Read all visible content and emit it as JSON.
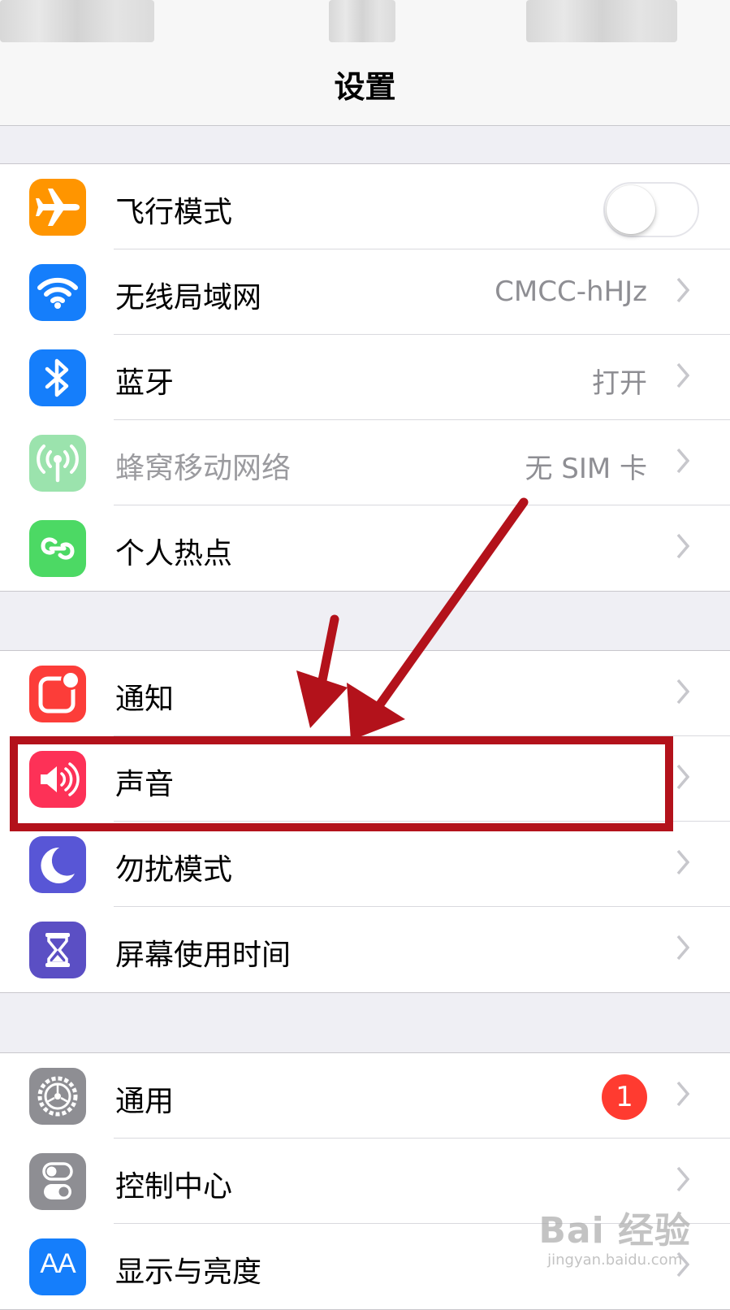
{
  "nav": {
    "title": "设置"
  },
  "group1": {
    "items": [
      {
        "label": "飞行模式",
        "icon": "airplane-icon",
        "color": "#ff9500",
        "toggle": false
      },
      {
        "label": "无线局域网",
        "icon": "wifi-icon",
        "color": "#157efb",
        "detail": "CMCC-hHJz"
      },
      {
        "label": "蓝牙",
        "icon": "bluetooth-icon",
        "color": "#157efb",
        "detail": "打开"
      },
      {
        "label": "蜂窝移动网络",
        "icon": "cellular-icon",
        "color": "#9be3ad",
        "detail": "无 SIM 卡",
        "disabled": true
      },
      {
        "label": "个人热点",
        "icon": "hotspot-icon",
        "color": "#4cd964"
      }
    ]
  },
  "group2": {
    "items": [
      {
        "label": "通知",
        "icon": "notifications-icon",
        "color": "#fc3d39"
      },
      {
        "label": "声音",
        "icon": "speaker-icon",
        "color": "#fd3157",
        "highlighted": true
      },
      {
        "label": "勿扰模式",
        "icon": "moon-icon",
        "color": "#5856d6"
      },
      {
        "label": "屏幕使用时间",
        "icon": "hourglass-icon",
        "color": "#5b4fc4"
      }
    ]
  },
  "group3": {
    "items": [
      {
        "label": "通用",
        "icon": "gear-icon",
        "color": "#8e8e93",
        "badge": "1"
      },
      {
        "label": "控制中心",
        "icon": "switches-icon",
        "color": "#8e8e93"
      },
      {
        "label": "显示与亮度",
        "icon": "text-size-icon",
        "color": "#157efb",
        "glyph": "AA"
      }
    ]
  },
  "annotation": {
    "color": "#b3121b"
  },
  "watermark": {
    "logo": "Bai 经验",
    "url": "jingyan.baidu.com"
  }
}
